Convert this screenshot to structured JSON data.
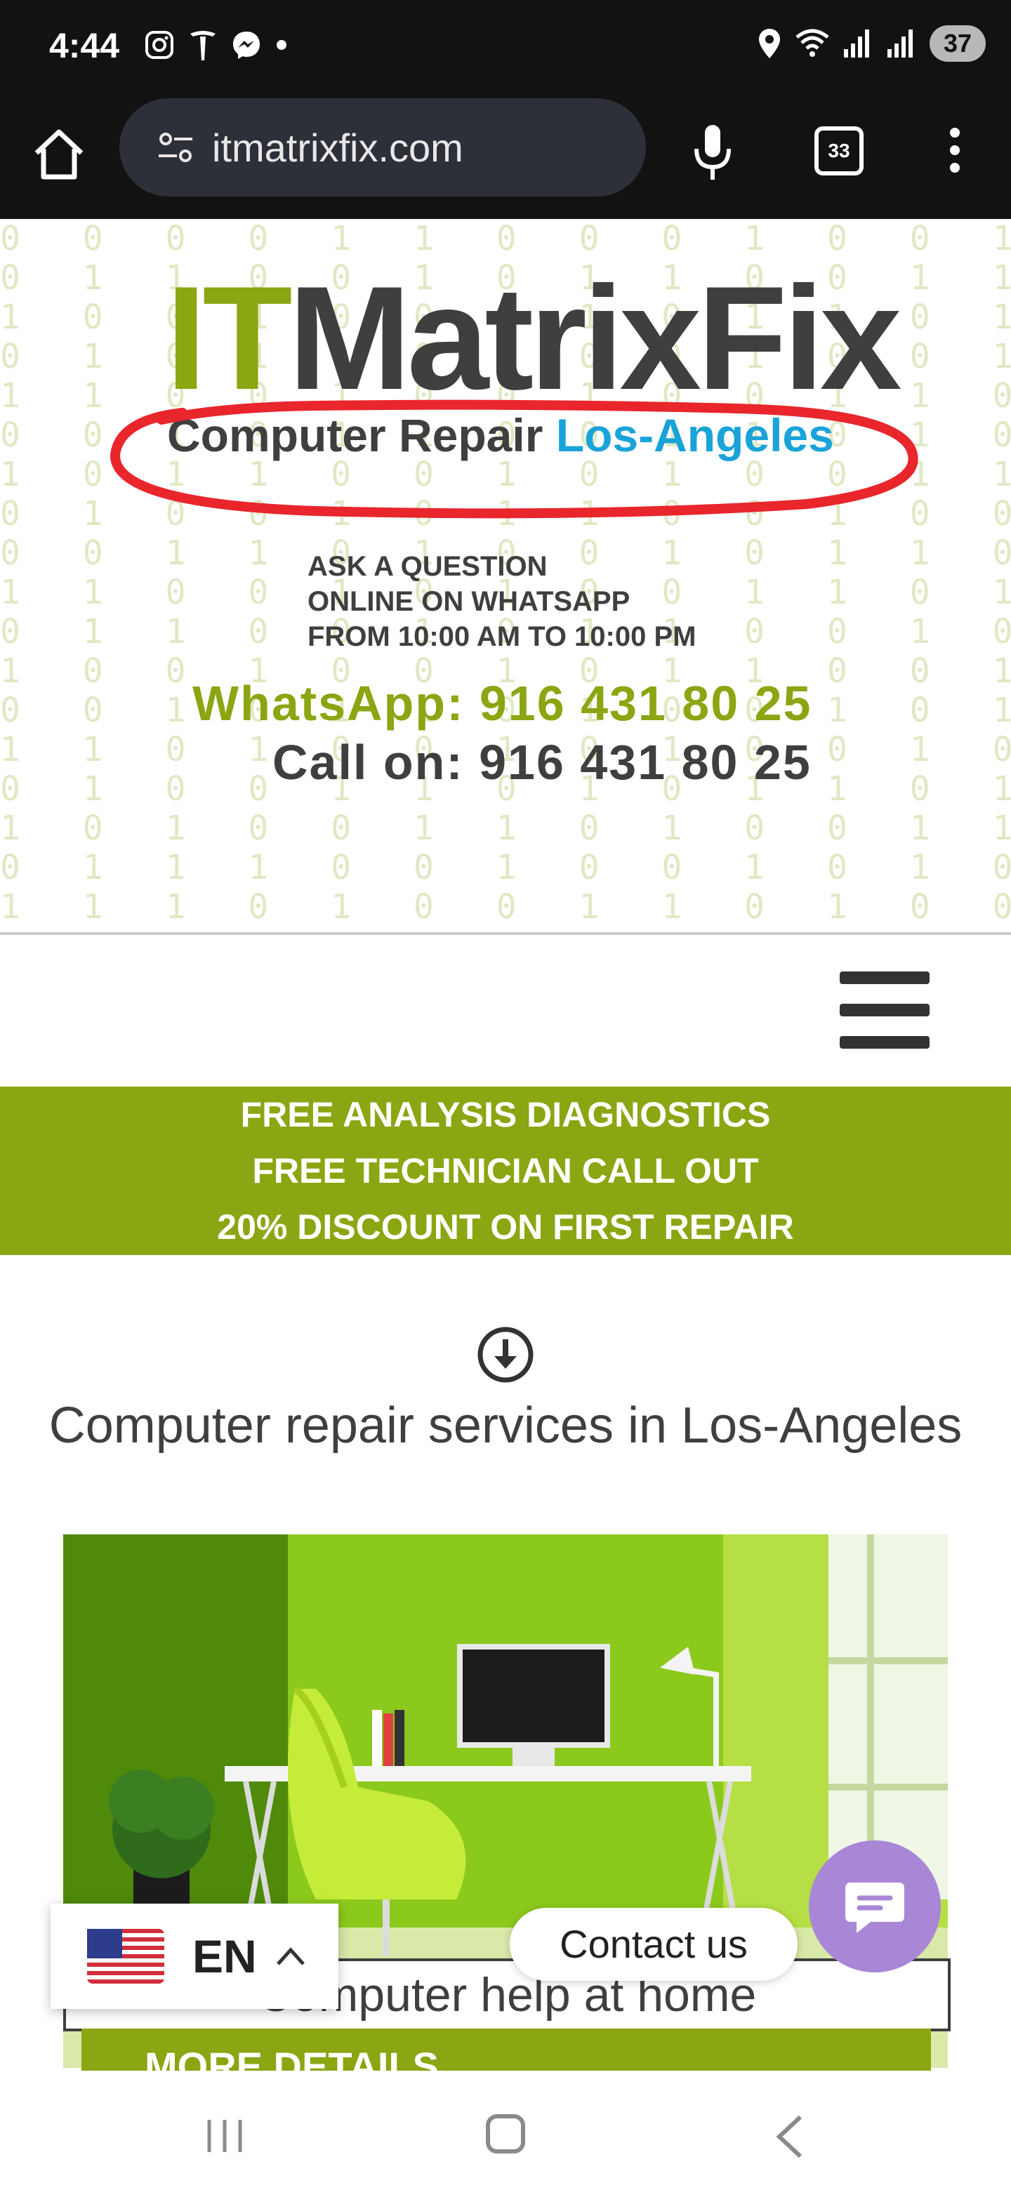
{
  "status_bar": {
    "time": "4:44",
    "battery": "37",
    "left_icons": [
      "instagram-icon",
      "tesla-icon",
      "messenger-icon",
      "dot-icon"
    ],
    "right_icons": [
      "location-icon",
      "wifi-icon",
      "signal-icon",
      "signal-icon"
    ]
  },
  "browser": {
    "url": "itmatrixfix.com",
    "tab_count": "33"
  },
  "banner": {
    "logo_it": "IT",
    "logo_rest": "MatrixFix",
    "tagline_main": "Computer Repair",
    "tagline_city": "Los-Angeles",
    "ask_lines": [
      "ASK A QUESTION",
      "ONLINE ON WHATSAPP",
      "FROM 10:00 AM TO 10:00 PM"
    ],
    "whatsapp": "WhatsApp: 916 431 80 25",
    "call": "Call on: 916 431 80 25"
  },
  "promo": {
    "lines": [
      "FREE ANALYSIS DIAGNOSTICS",
      "FREE TECHNICIAN CALL OUT",
      "20% DISCOUNT ON FIRST REPAIR"
    ]
  },
  "content": {
    "section_title": "Computer repair services in Los-Angeles",
    "hero_caption": "Computer help at home",
    "more_button": "MORE DETAILS"
  },
  "widgets": {
    "language": "EN",
    "contact": "Contact us"
  },
  "colors": {
    "accent_green": "#8aa612",
    "accent_blue": "#1aa3d9",
    "dark_text": "#3f3f3f",
    "chat_purple": "#a987d6"
  }
}
